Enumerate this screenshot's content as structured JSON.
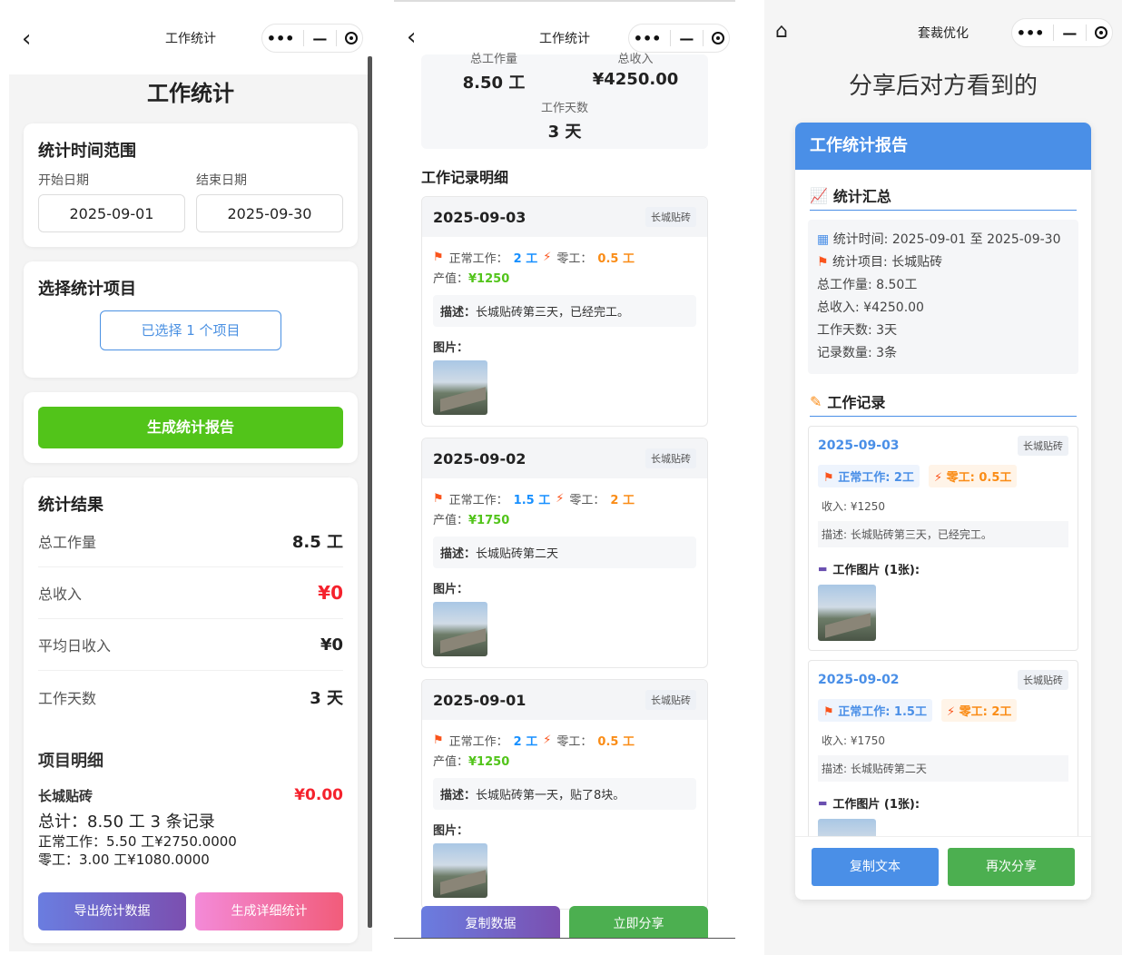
{
  "phone1": {
    "nav_title": "工作统计",
    "page_title": "工作统计",
    "time_range": {
      "title": "统计时间范围",
      "start_label": "开始日期",
      "end_label": "结束日期",
      "start_value": "2025-09-01",
      "end_value": "2025-09-30"
    },
    "project_select": {
      "title": "选择统计项目",
      "button": "已选择 1 个项目"
    },
    "generate_button": "生成统计报告",
    "results": {
      "title": "统计结果",
      "rows": [
        {
          "label": "总工作量",
          "value": "8.5 工"
        },
        {
          "label": "总收入",
          "value": "¥0"
        },
        {
          "label": "平均日收入",
          "value": "¥0"
        },
        {
          "label": "工作天数",
          "value": "3 天"
        }
      ],
      "detail_title": "项目明细",
      "project_name": "长城贴砖",
      "project_amount": "¥0.00",
      "project_total": "总计：8.50 工  3 条记录",
      "normal_line": "正常工作：5.50 工¥2750.0000",
      "extra_line": "零工：3.00 工¥1080.0000"
    },
    "export_button": "导出统计数据",
    "detail_button": "生成详细统计"
  },
  "phone2": {
    "nav_title": "工作统计",
    "summary": {
      "total_work_label": "总工作量",
      "total_work_value": "8.50 工",
      "total_income_label": "总收入",
      "total_income_value": "¥4250.00",
      "days_label": "工作天数",
      "days_value": "3 天"
    },
    "section_title": "工作记录明细",
    "labels": {
      "normal": "正常工作：",
      "extra": "零工：",
      "value": "产值：",
      "desc": "描述：",
      "images": "图片："
    },
    "records": [
      {
        "date": "2025-09-03",
        "tag": "长城贴砖",
        "normal": "2 工",
        "extra": "0.5 工",
        "value": "¥1250",
        "desc": "长城贴砖第三天，已经完工。"
      },
      {
        "date": "2025-09-02",
        "tag": "长城贴砖",
        "normal": "1.5 工",
        "extra": "2 工",
        "value": "¥1750",
        "desc": "长城贴砖第二天"
      },
      {
        "date": "2025-09-01",
        "tag": "长城贴砖",
        "normal": "2 工",
        "extra": "0.5 工",
        "value": "¥1250",
        "desc": "长城贴砖第一天，贴了8块。"
      }
    ],
    "copy_button": "复制数据",
    "share_button": "立即分享"
  },
  "phone3": {
    "nav_title": "套裁优化",
    "heading": "分享后对方看到的",
    "report_title": "工作统计报告",
    "summary_title": "统计汇总",
    "summary_lines": [
      "统计时间: 2025-09-01 至 2025-09-30",
      "统计项目: 长城贴砖",
      "总工作量: 8.50工",
      "总收入: ¥4250.00",
      "工作天数: 3天",
      "记录数量: 3条"
    ],
    "records_title": "工作记录",
    "records": [
      {
        "date": "2025-09-03",
        "tag": "长城贴砖",
        "normal": "正常工作: 2工",
        "extra": "零工: 0.5工",
        "income": "收入: ¥1250",
        "desc": "描述: 长城贴砖第三天，已经完工。",
        "images": "工作图片 (1张):"
      },
      {
        "date": "2025-09-02",
        "tag": "长城贴砖",
        "normal": "正常工作: 1.5工",
        "extra": "零工: 2工",
        "income": "收入: ¥1750",
        "desc": "描述: 长城贴砖第二天",
        "images": "工作图片 (1张):"
      }
    ],
    "copy_text_button": "复制文本",
    "share_again_button": "再次分享"
  }
}
